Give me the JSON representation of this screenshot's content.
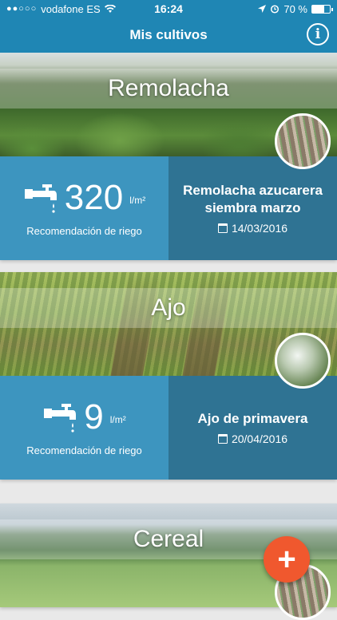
{
  "status_bar": {
    "carrier": "vodafone ES",
    "signal_dots": "●●○○○",
    "time": "16:24",
    "battery": "70 %"
  },
  "header": {
    "title": "Mis cultivos",
    "info_icon": "info-icon",
    "info_label": "i"
  },
  "crops": [
    {
      "name": "Remolacha",
      "riego_value": "320",
      "riego_unit": "l/m²",
      "riego_label": "Recomendación de riego",
      "description": "Remolacha azucarera siembra marzo",
      "date": "14/03/2016"
    },
    {
      "name": "Ajo",
      "riego_value": "9",
      "riego_unit": "l/m²",
      "riego_label": "Recomendación de riego",
      "description": "Ajo de primavera",
      "date": "20/04/2016"
    },
    {
      "name": "Cereal"
    }
  ],
  "fab": {
    "label": "+",
    "color": "#f0582e"
  },
  "colors": {
    "header": "#1f86b4",
    "left_panel": "#3d95bf",
    "right_panel": "#2f7393"
  }
}
